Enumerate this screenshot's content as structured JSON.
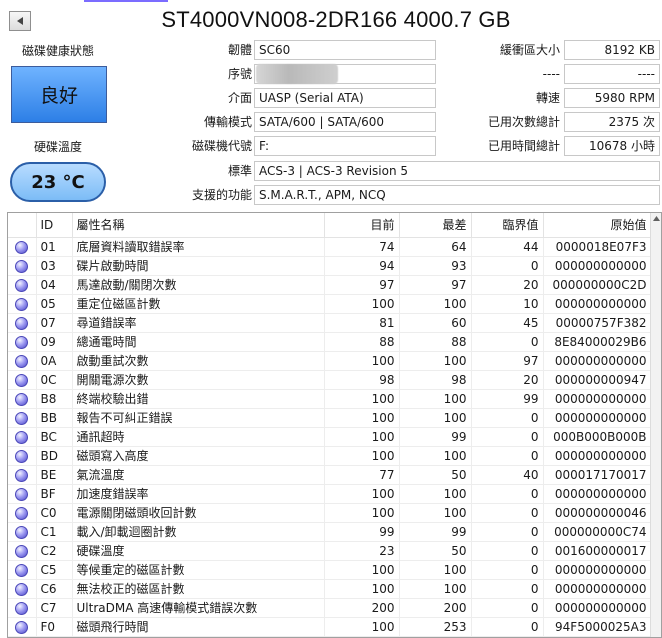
{
  "header": {
    "title": "ST4000VN008-2DR166 4000.7 GB"
  },
  "health": {
    "label": "磁碟健康狀態",
    "status": "良好",
    "color": "#3a8cf0"
  },
  "temperature": {
    "label": "硬碟溫度",
    "value": "23 °C"
  },
  "info_left": [
    {
      "label": "韌體",
      "value": "SC60"
    },
    {
      "label": "序號",
      "value": ""
    },
    {
      "label": "介面",
      "value": "UASP (Serial ATA)"
    },
    {
      "label": "傳輸模式",
      "value": "SATA/600 | SATA/600"
    },
    {
      "label": "磁碟機代號",
      "value": "F:"
    },
    {
      "label": "標準",
      "value": "ACS-3 | ACS-3 Revision 5"
    },
    {
      "label": "支援的功能",
      "value": "S.M.A.R.T., APM, NCQ"
    }
  ],
  "info_right": [
    {
      "label": "緩衝區大小",
      "value": "8192 KB"
    },
    {
      "label": "----",
      "value": "----"
    },
    {
      "label": "轉速",
      "value": "5980 RPM"
    },
    {
      "label": "已用次數總計",
      "value": "2375 次"
    },
    {
      "label": "已用時間總計",
      "value": "10678 小時"
    }
  ],
  "smart_table": {
    "columns": [
      "ID",
      "屬性名稱",
      "目前",
      "最差",
      "臨界值",
      "原始值"
    ],
    "rows": [
      {
        "id": "01",
        "name": "底層資料讀取錯誤率",
        "current": "74",
        "worst": "64",
        "threshold": "44",
        "raw": "0000018E07F3"
      },
      {
        "id": "03",
        "name": "碟片啟動時間",
        "current": "94",
        "worst": "93",
        "threshold": "0",
        "raw": "000000000000"
      },
      {
        "id": "04",
        "name": "馬達啟動/關閉次數",
        "current": "97",
        "worst": "97",
        "threshold": "20",
        "raw": "000000000C2D"
      },
      {
        "id": "05",
        "name": "重定位磁區計數",
        "current": "100",
        "worst": "100",
        "threshold": "10",
        "raw": "000000000000"
      },
      {
        "id": "07",
        "name": "尋道錯誤率",
        "current": "81",
        "worst": "60",
        "threshold": "45",
        "raw": "00000757F382"
      },
      {
        "id": "09",
        "name": "總通電時間",
        "current": "88",
        "worst": "88",
        "threshold": "0",
        "raw": "8E84000029B6"
      },
      {
        "id": "0A",
        "name": "啟動重試次數",
        "current": "100",
        "worst": "100",
        "threshold": "97",
        "raw": "000000000000"
      },
      {
        "id": "0C",
        "name": "開關電源次數",
        "current": "98",
        "worst": "98",
        "threshold": "20",
        "raw": "000000000947"
      },
      {
        "id": "B8",
        "name": "終端校驗出錯",
        "current": "100",
        "worst": "100",
        "threshold": "99",
        "raw": "000000000000"
      },
      {
        "id": "BB",
        "name": "報告不可糾正錯誤",
        "current": "100",
        "worst": "100",
        "threshold": "0",
        "raw": "000000000000"
      },
      {
        "id": "BC",
        "name": "通訊超時",
        "current": "100",
        "worst": "99",
        "threshold": "0",
        "raw": "000B000B000B"
      },
      {
        "id": "BD",
        "name": "磁頭寫入高度",
        "current": "100",
        "worst": "100",
        "threshold": "0",
        "raw": "000000000000"
      },
      {
        "id": "BE",
        "name": "氣流溫度",
        "current": "77",
        "worst": "50",
        "threshold": "40",
        "raw": "000017170017"
      },
      {
        "id": "BF",
        "name": "加速度錯誤率",
        "current": "100",
        "worst": "100",
        "threshold": "0",
        "raw": "000000000000"
      },
      {
        "id": "C0",
        "name": "電源關閉磁頭收回計數",
        "current": "100",
        "worst": "100",
        "threshold": "0",
        "raw": "000000000046"
      },
      {
        "id": "C1",
        "name": "載入/卸載迴圈計數",
        "current": "99",
        "worst": "99",
        "threshold": "0",
        "raw": "000000000C74"
      },
      {
        "id": "C2",
        "name": "硬碟溫度",
        "current": "23",
        "worst": "50",
        "threshold": "0",
        "raw": "001600000017"
      },
      {
        "id": "C5",
        "name": "等候重定的磁區計數",
        "current": "100",
        "worst": "100",
        "threshold": "0",
        "raw": "000000000000"
      },
      {
        "id": "C6",
        "name": "無法校正的磁區計數",
        "current": "100",
        "worst": "100",
        "threshold": "0",
        "raw": "000000000000"
      },
      {
        "id": "C7",
        "name": "UltraDMA 高速傳輸模式錯誤次數",
        "current": "200",
        "worst": "200",
        "threshold": "0",
        "raw": "000000000000"
      },
      {
        "id": "F0",
        "name": "磁頭飛行時間",
        "current": "100",
        "worst": "253",
        "threshold": "0",
        "raw": "94F5000025A3"
      }
    ]
  }
}
